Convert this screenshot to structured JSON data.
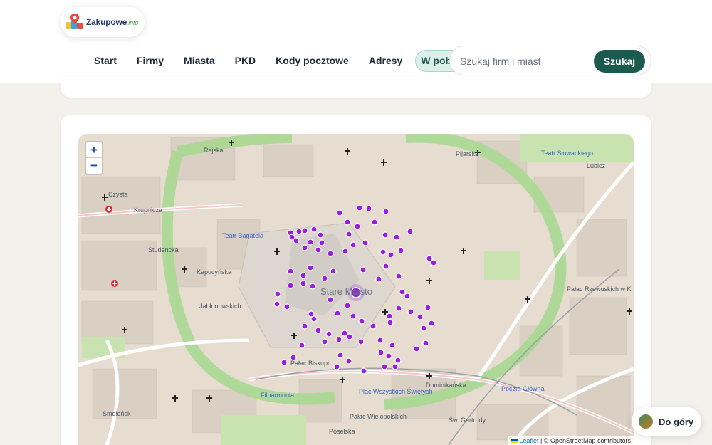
{
  "brand": {
    "name": "Zakupowe",
    "tld": ".info"
  },
  "nav": {
    "items": [
      {
        "label": "Start"
      },
      {
        "label": "Firmy"
      },
      {
        "label": "Miasta"
      },
      {
        "label": "PKD"
      },
      {
        "label": "Kody pocztowe"
      },
      {
        "label": "Adresy"
      },
      {
        "label": "W pobliżu"
      }
    ],
    "active_index": 6
  },
  "search": {
    "placeholder": "Szukaj firm i miast",
    "button_label": "Szukaj"
  },
  "map": {
    "zoom_in": "+",
    "zoom_out": "−",
    "center_label": "Stare Miasto",
    "labels": {
      "krupnicza": "Krupnicza",
      "studencka": "Studencka",
      "kapucynska": "Kapucyńska",
      "jablonowskich": "Jabłonowskich",
      "teatr_bagatela": "Teatr Bagatela",
      "teatr_slowackiego": "Teatr Słowackiego",
      "palac_biskupi": "Pałac Biskupi",
      "palac_wielopolskich": "Pałac Wielopolskich",
      "plac_wszystkich": "Plac Wszystkich Świętych",
      "poczta_glowna": "Poczta Główna",
      "filharmonia": "Filharmonia",
      "pijarska": "Pijarska",
      "lubicz": "Lubicz",
      "dominikanska": "Dominikańska",
      "sw_gertrudy": "Św. Gertrudy",
      "muzeum_rz": "Pałac Rzewuskich w Krakowie",
      "poselska": "Poselska",
      "smolensk": "Smoleńsk",
      "czysta": "Czysta",
      "rajska": "Rajska"
    },
    "marker_color": "#9b1de0",
    "attribution_link": "Leaflet",
    "attribution_text": "| © OpenStreetMap contributors"
  },
  "to_top": {
    "label": "Do góry"
  }
}
